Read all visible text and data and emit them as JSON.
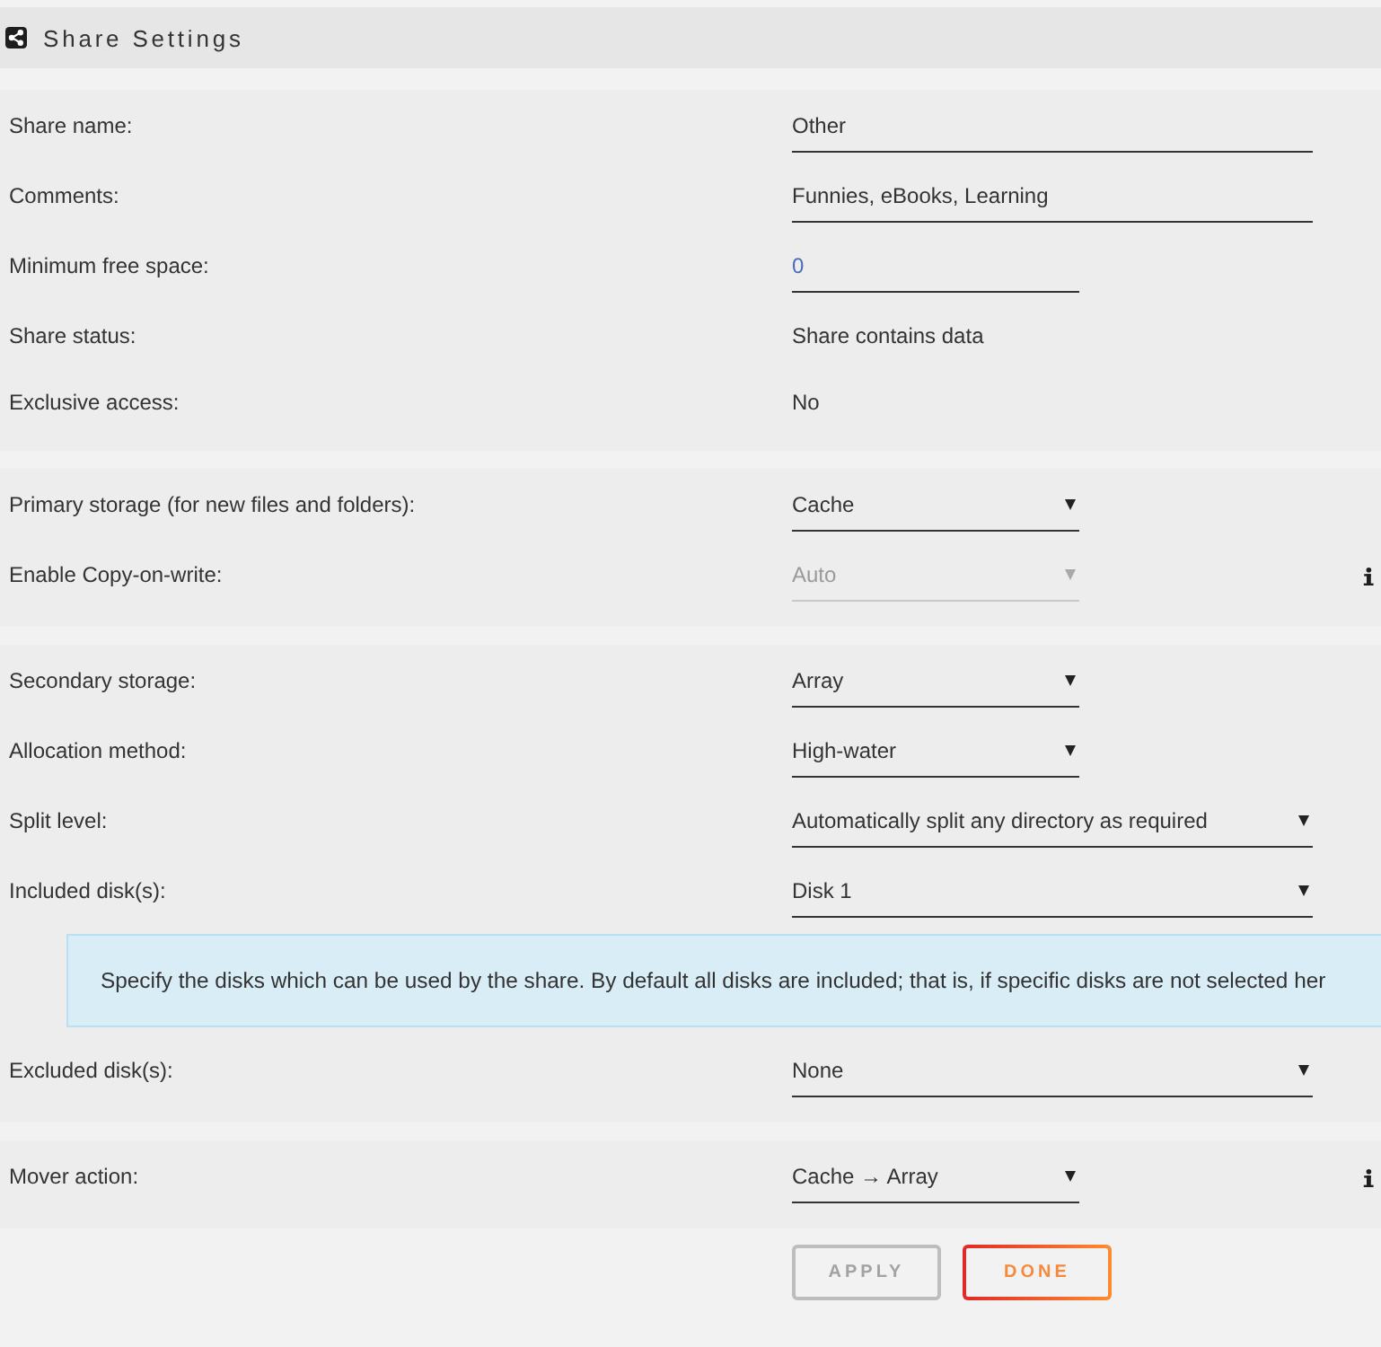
{
  "header": {
    "title": "Share Settings"
  },
  "sections": [
    {
      "rows": [
        {
          "kind": "input",
          "label": "Share name:",
          "value": "Other",
          "info": false
        },
        {
          "kind": "input",
          "label": "Comments:",
          "value": "Funnies, eBooks, Learning",
          "info": false
        },
        {
          "kind": "input",
          "label": "Minimum free space:",
          "placeholder": "0",
          "info": false
        },
        {
          "kind": "text",
          "label": "Share status:",
          "value": "Share contains data",
          "info": false
        },
        {
          "kind": "text",
          "label": "Exclusive access:",
          "value": "No",
          "info": false
        }
      ]
    },
    {
      "rows": [
        {
          "kind": "select",
          "label": "Primary storage (for new files and folders):",
          "value": "Cache",
          "disabled": false,
          "info": false
        },
        {
          "kind": "select",
          "label": "Enable Copy-on-write:",
          "value": "Auto",
          "disabled": true,
          "info": true
        }
      ]
    },
    {
      "rows": [
        {
          "kind": "select",
          "label": "Secondary storage:",
          "value": "Array",
          "disabled": false,
          "info": false
        },
        {
          "kind": "select",
          "label": "Allocation method:",
          "value": "High-water",
          "disabled": false,
          "info": false
        },
        {
          "kind": "select",
          "label": "Split level:",
          "value": "Automatically split any directory as required",
          "disabled": false,
          "info": false
        },
        {
          "kind": "select",
          "label": "Included disk(s):",
          "value": "Disk 1",
          "disabled": false,
          "info": false
        },
        {
          "kind": "note",
          "text": "Specify the disks which can be used by the share. By default all disks are included; that is, if specific disks are not selected her",
          "info": false
        },
        {
          "kind": "select",
          "label": "Excluded disk(s):",
          "value": "None",
          "disabled": false,
          "info": false
        }
      ]
    },
    {
      "rows": [
        {
          "kind": "select",
          "label": "Mover action:",
          "value": "Cache → Array",
          "disabled": false,
          "info": true
        }
      ]
    }
  ],
  "buttons": [
    {
      "label": "APPLY",
      "disabled": true
    },
    {
      "label": "DONE",
      "disabled": false
    }
  ]
}
